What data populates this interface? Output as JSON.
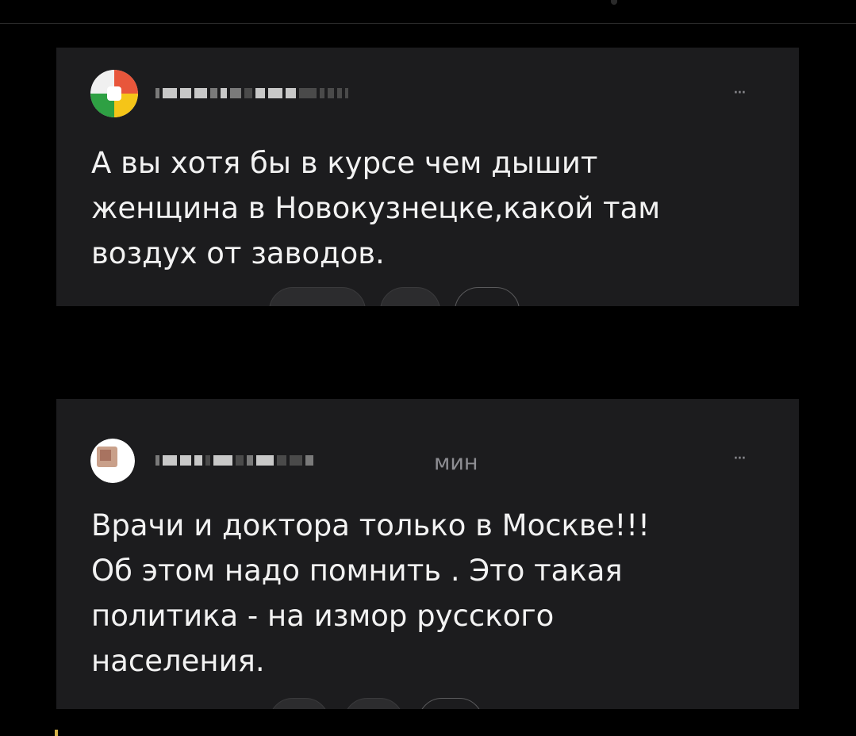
{
  "comments": [
    {
      "author": "",
      "time": "",
      "more_label": "···",
      "text": "А вы хотя бы в курсе чем дышит\nженщина в Новокузнецке,какой там\nвоздух от заводов.",
      "avatar_colors": [
        "#e8563b",
        "#f5c518",
        "#2ea043",
        "#ffffff"
      ]
    },
    {
      "author": "",
      "time": "мин",
      "more_label": "···",
      "text": "Врачи и доктора только в Москве!!!\nОб этом надо помнить . Это такая\nполитика - на измор русского\nнаселения.",
      "avatar_colors": [
        "#ffffff",
        "#c9a08a"
      ]
    }
  ],
  "colors": {
    "background": "#000000",
    "card": "#1c1c1e",
    "text": "#f2f2f2",
    "muted": "#8e8e93"
  }
}
